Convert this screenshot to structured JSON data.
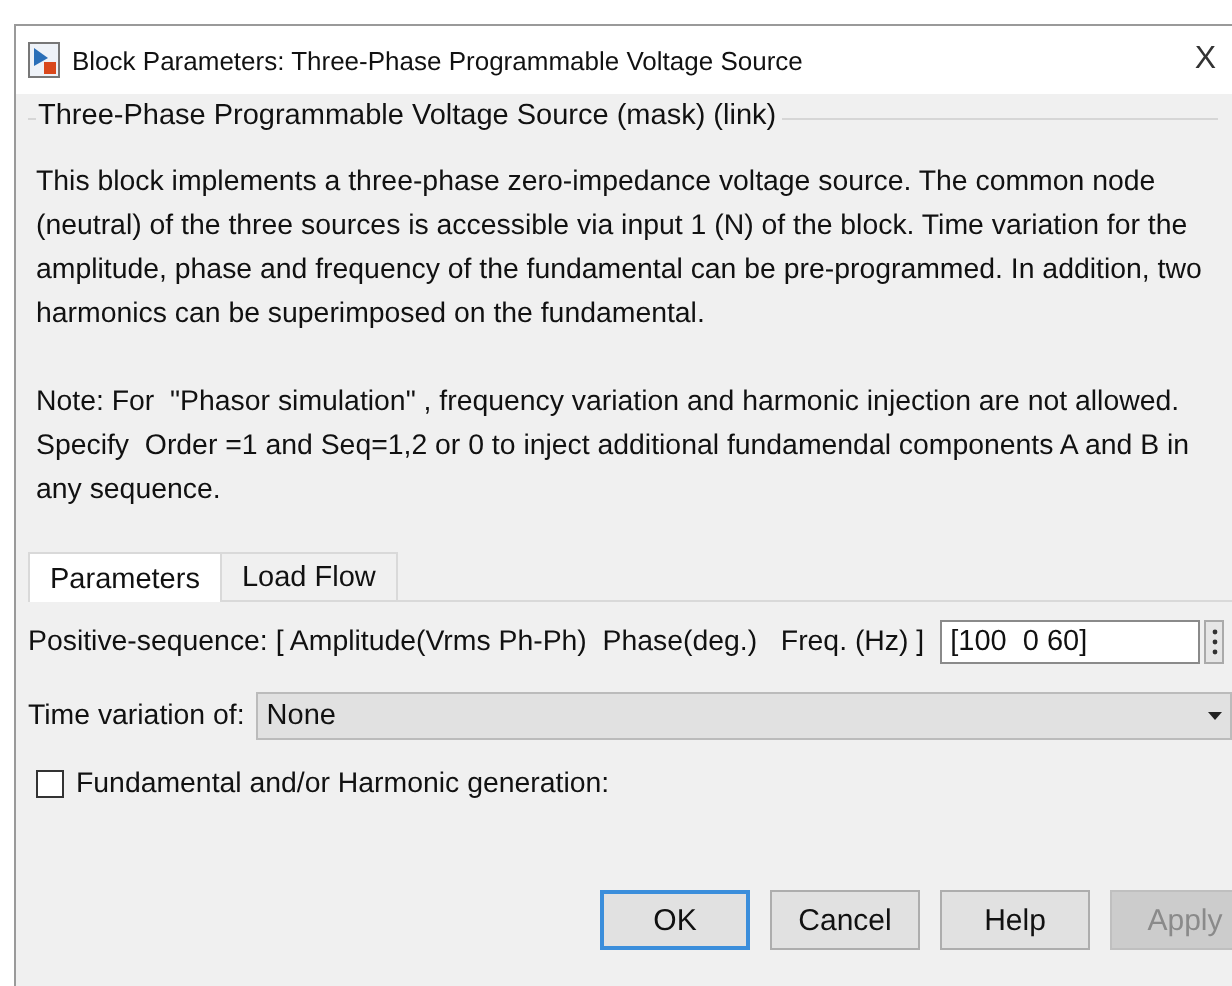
{
  "window": {
    "title": "Block Parameters: Three-Phase Programmable Voltage Source",
    "close": "X"
  },
  "group": {
    "title": "Three-Phase Programmable Voltage Source (mask) (link)",
    "description": "This block implements a three-phase zero-impedance voltage source. The common node (neutral) of the three sources is accessible via input 1 (N) of the block. Time variation for the amplitude, phase and frequency of the fundamental can be pre-programmed. In addition, two harmonics can be superimposed on the fundamental.",
    "note": "Note: For  \"Phasor simulation\" , frequency variation and harmonic injection are not allowed. Specify  Order =1 and Seq=1,2 or 0 to inject additional fundamendal components A and B in any sequence."
  },
  "tabs": [
    {
      "label": "Parameters",
      "selected": true
    },
    {
      "label": "Load Flow",
      "selected": false
    }
  ],
  "parameters": {
    "positive_sequence": {
      "label": "Positive-sequence: [ Amplitude(Vrms Ph-Ph)  Phase(deg.)   Freq. (Hz) ]",
      "value": "[100  0 60]"
    },
    "time_variation": {
      "label": "Time variation of:",
      "value": "None"
    },
    "harmonic_generation": {
      "label": "Fundamental and/or Harmonic generation:",
      "checked": false
    }
  },
  "buttons": [
    {
      "label": "OK",
      "default": true,
      "disabled": false
    },
    {
      "label": "Cancel",
      "default": false,
      "disabled": false
    },
    {
      "label": "Help",
      "default": false,
      "disabled": false
    },
    {
      "label": "Apply",
      "default": false,
      "disabled": true
    }
  ]
}
